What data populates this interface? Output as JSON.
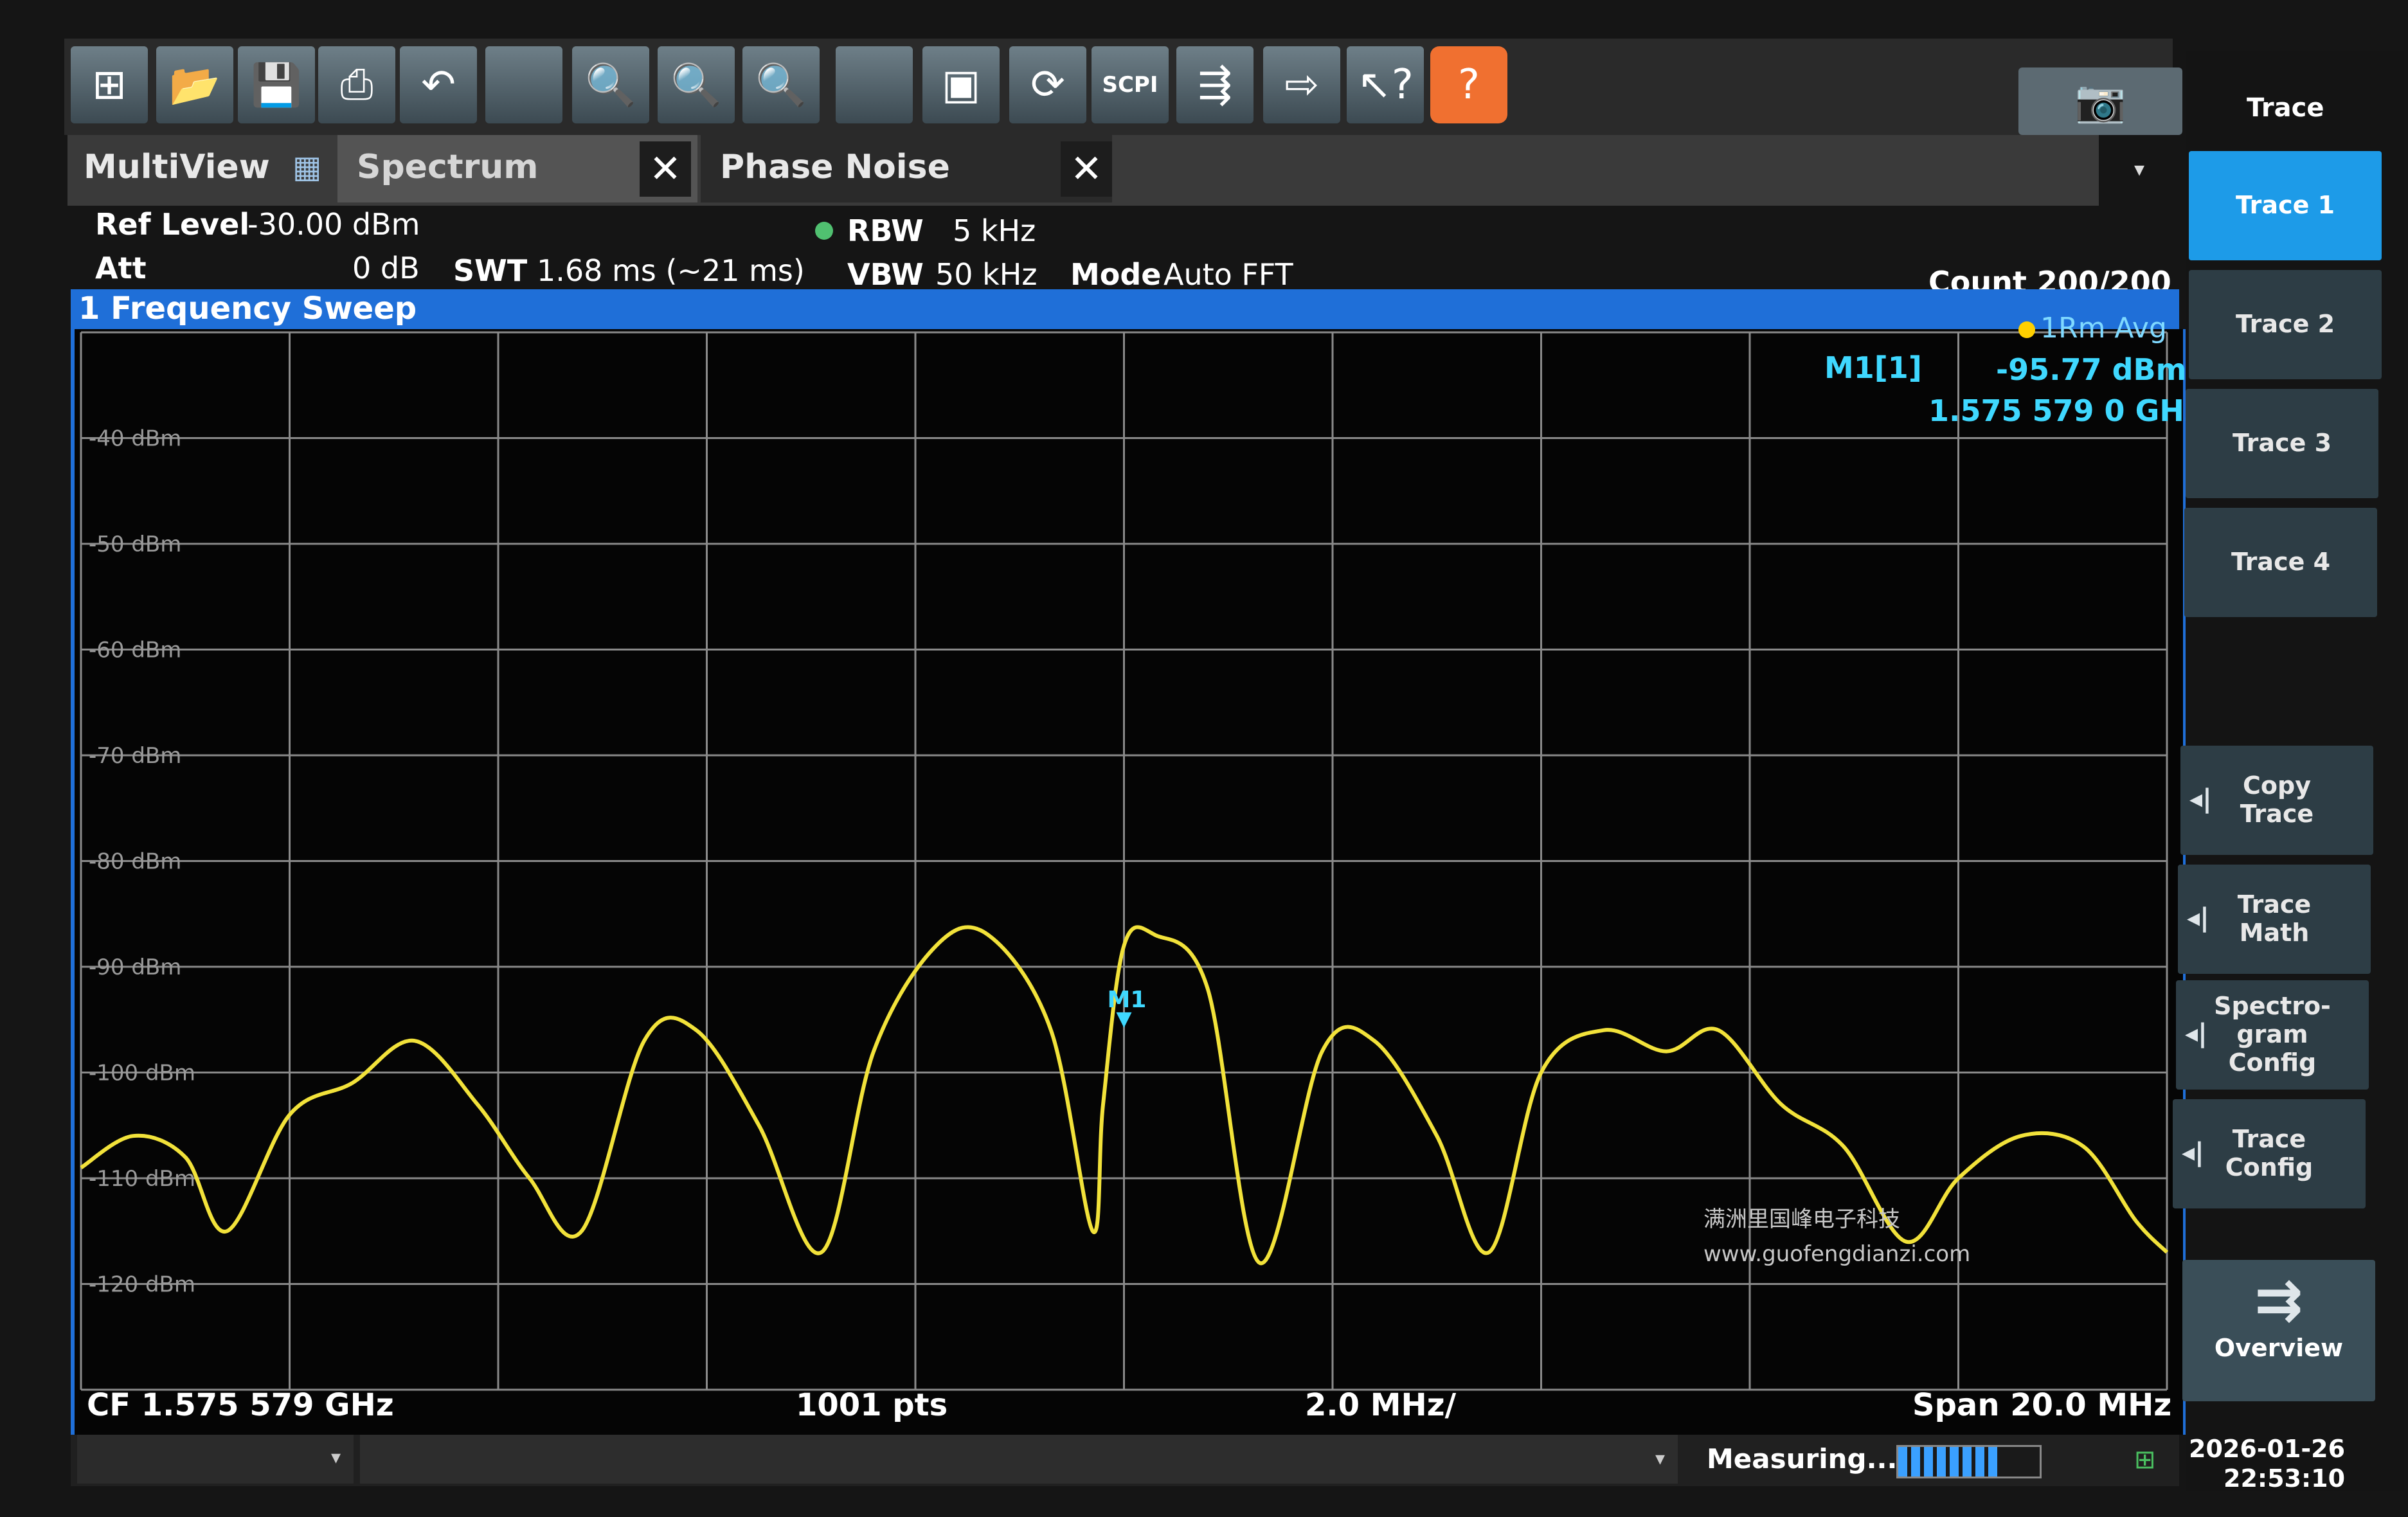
{
  "toolbar": {
    "buttons": [
      {
        "icon": "windows-icon",
        "glyph": "⊞"
      },
      {
        "icon": "open-folder-icon",
        "glyph": "📂"
      },
      {
        "icon": "save-icon",
        "glyph": "💾"
      },
      {
        "icon": "print-icon",
        "glyph": "⎙"
      },
      {
        "icon": "undo-icon",
        "glyph": "↶"
      },
      {
        "icon": "blank-icon",
        "glyph": ""
      },
      {
        "icon": "zoom-icon",
        "glyph": "🔍"
      },
      {
        "icon": "multi-zoom-icon",
        "glyph": "🔍"
      },
      {
        "icon": "zoom-all-icon",
        "glyph": "🔍"
      },
      {
        "icon": "zoom-1to1-icon",
        "glyph": ""
      },
      {
        "icon": "full-screen-icon",
        "glyph": "▣"
      },
      {
        "icon": "refresh-icon",
        "glyph": "⟳"
      },
      {
        "icon": "scpi-icon",
        "glyph": "SCPI"
      },
      {
        "icon": "sequencer-icon",
        "glyph": "⇶"
      },
      {
        "icon": "export-icon",
        "glyph": "⇨"
      },
      {
        "icon": "help-pointer-icon",
        "glyph": "↖?"
      },
      {
        "icon": "help-icon",
        "glyph": "?"
      }
    ],
    "camera_icon": "camera-icon"
  },
  "tabs": {
    "multiview": "MultiView",
    "spectrum": "Spectrum",
    "phase_noise": "Phase Noise",
    "close_glyph": "✕"
  },
  "settings": {
    "ref_level_label": "Ref Level",
    "ref_level_value": "-30.00 dBm",
    "att_label": "Att",
    "att_value": "0 dB",
    "swt_label": "SWT",
    "swt_value": "1.68 ms (~21 ms)",
    "rbw_label": "RBW",
    "rbw_value": "5 kHz",
    "vbw_label": "VBW",
    "vbw_value": "50 kHz",
    "mode_label": "Mode",
    "mode_value": "Auto FFT",
    "count": "Count 200/200"
  },
  "window": {
    "title": "1 Frequency Sweep",
    "trace_indicator": "1Rm Avg"
  },
  "marker": {
    "name": "M1[1]",
    "level": "-95.77 dBm",
    "freq": "1.575 579 0 GHz",
    "label": "M1"
  },
  "footer": {
    "cf": "CF 1.575 579 GHz",
    "pts": "1001 pts",
    "div": "2.0 MHz/",
    "span": "Span 20.0 MHz"
  },
  "sidebar": {
    "title": "Trace",
    "keys": [
      "Trace 1",
      "Trace 2",
      "Trace 3",
      "Trace 4"
    ],
    "actions": [
      "Copy Trace",
      "Trace Math",
      "Spectro-gram Config",
      "Trace Config"
    ],
    "overview": "Overview"
  },
  "status": {
    "measuring": "Measuring...",
    "date": "2026-01-26",
    "time": "22:53:10",
    "progress_fraction": 0.7
  },
  "watermark": {
    "line1": "满洲里国峰电子科技",
    "line2": "www.guofengdianzi.com"
  },
  "chart_data": {
    "type": "line",
    "ylabels": [
      "-40 dBm",
      "-50 dBm",
      "-60 dBm",
      "-70 dBm",
      "-80 dBm",
      "-90 dBm",
      "-100 dBm",
      "-110 dBm",
      "-120 dBm"
    ],
    "ylim": [
      -130,
      -30
    ],
    "xlim_mhz": [
      -10,
      10
    ],
    "trace_color": "#f2e23a",
    "grid_color": "#8a8a8a",
    "series": [
      {
        "x": [
          -10,
          -9.5,
          -9.0,
          -8.6,
          -8.0,
          -7.4,
          -6.8,
          -6.2,
          -5.7,
          -5.2,
          -4.6,
          -4.1,
          -3.5,
          -2.9,
          -2.4,
          -1.8,
          -1.3,
          -0.7,
          -0.3,
          -0.2,
          0.0,
          0.3,
          0.8,
          1.3,
          1.9,
          2.4,
          3.0,
          3.5,
          4.0,
          4.6,
          5.2,
          5.7,
          6.3,
          6.9,
          7.5,
          8.0,
          8.6,
          9.2,
          9.7,
          10.0
        ],
        "y": [
          -109,
          -106,
          -108,
          -115,
          -104,
          -101,
          -97,
          -103,
          -110,
          -115,
          -97,
          -96,
          -105,
          -117,
          -98,
          -88,
          -87,
          -96,
          -115,
          -103,
          -88,
          -87,
          -92,
          -118,
          -98,
          -97,
          -106,
          -117,
          -100,
          -96,
          -98,
          -96,
          -103,
          -107,
          -116,
          -110,
          -106,
          -107,
          -114,
          -117
        ]
      }
    ]
  }
}
